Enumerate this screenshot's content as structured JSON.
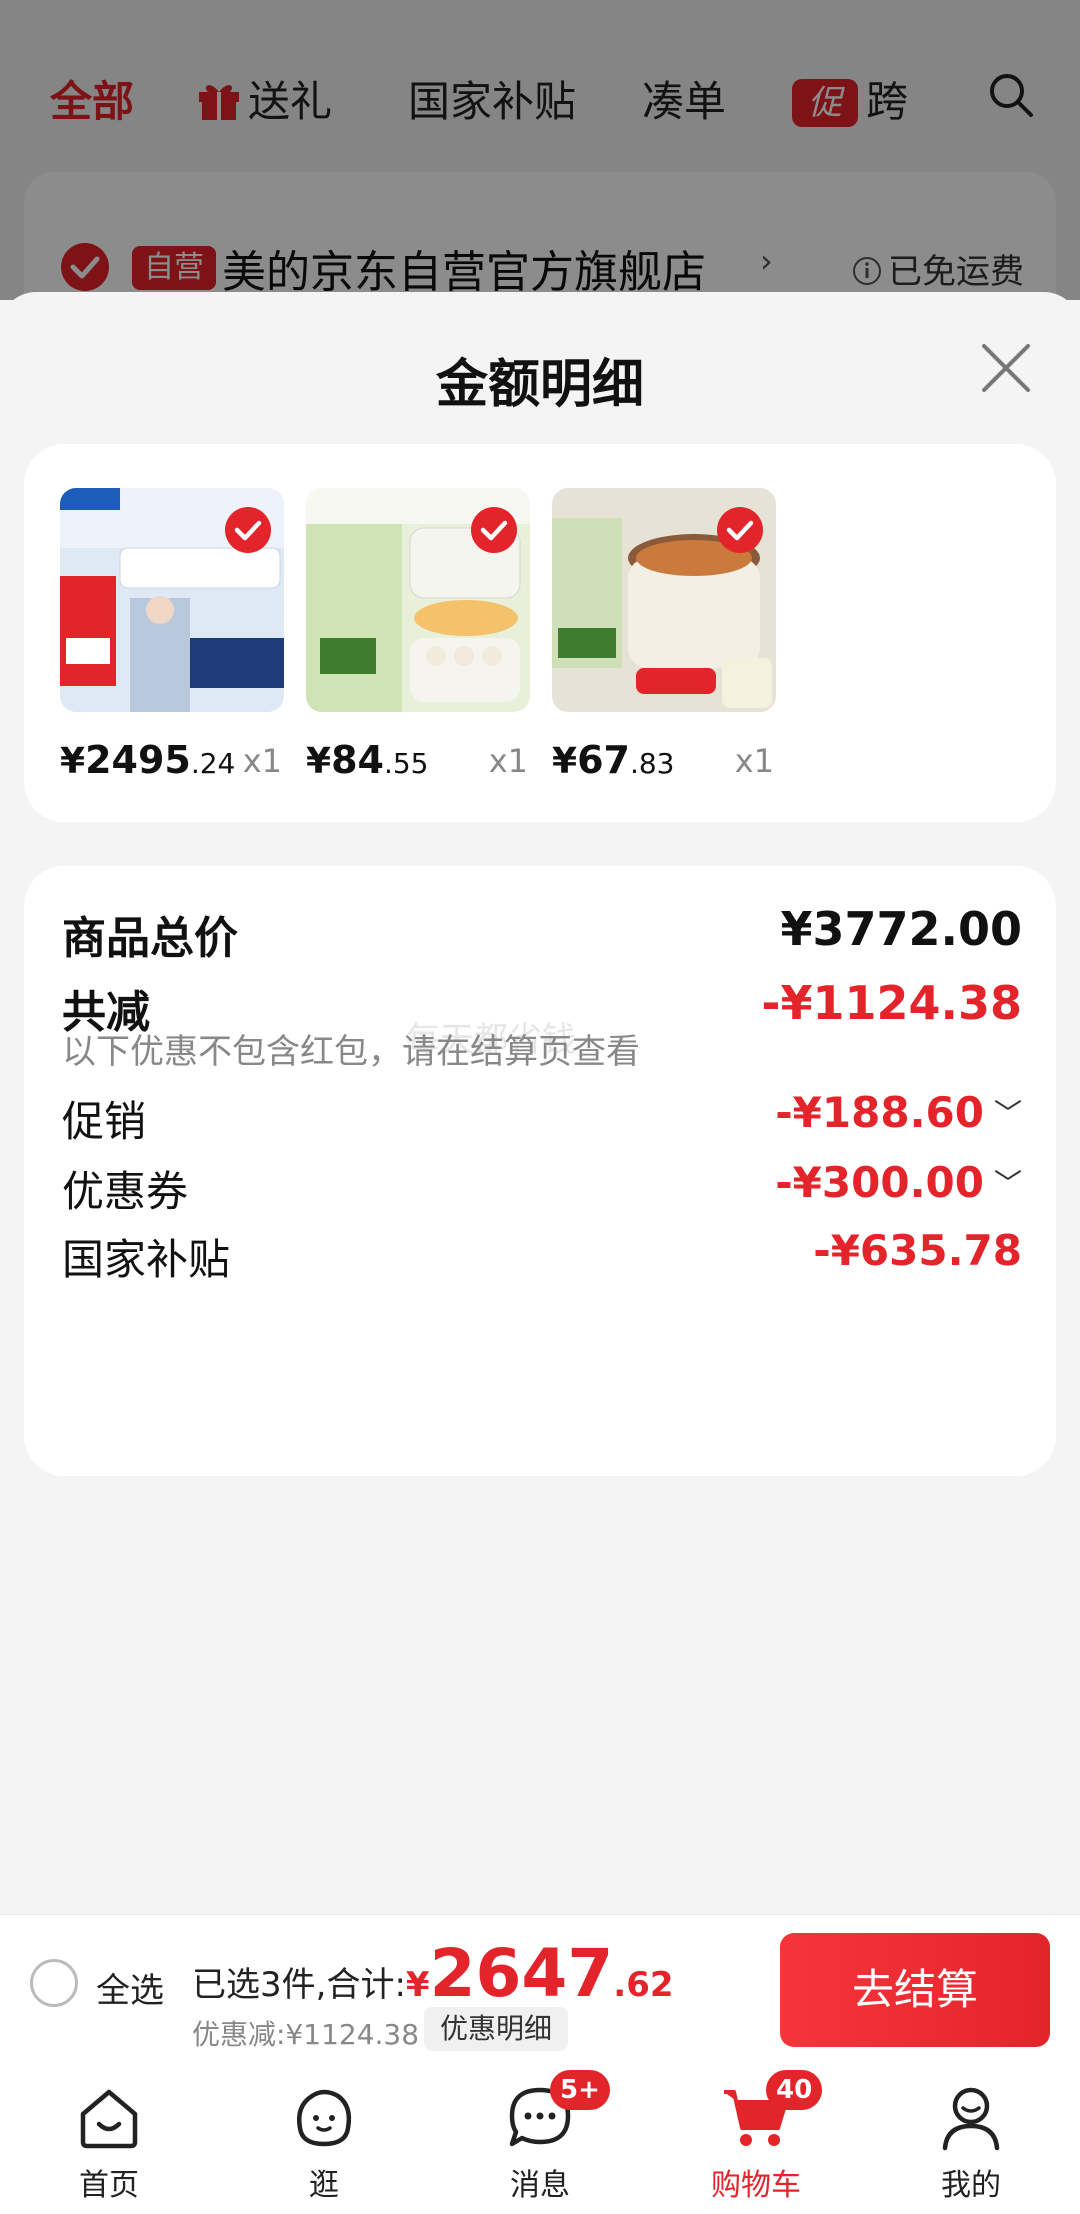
{
  "background": {
    "tabs": [
      {
        "label": "全部",
        "active": true
      },
      {
        "label": "送礼",
        "icon": "gift-icon"
      },
      {
        "label": "国家补贴"
      },
      {
        "label": "凑单"
      },
      {
        "label": "跨",
        "badge": "促"
      }
    ],
    "store": {
      "badge": "自营",
      "name": "美的京东自营官方旗舰店",
      "arrow": "›",
      "shipping": "已免运费"
    }
  },
  "sheet": {
    "title": "金额明细",
    "products": [
      {
        "yen": "¥",
        "int": "2495",
        "dec": ".24",
        "qty": "x1",
        "thumb": "air-conditioner"
      },
      {
        "yen": "¥",
        "int": "84",
        "dec": ".55",
        "qty": "x1",
        "thumb": "egg-steamer"
      },
      {
        "yen": "¥",
        "int": "67",
        "dec": ".83",
        "qty": "x1",
        "thumb": "electric-cooker"
      }
    ],
    "summary": {
      "total_label": "商品总价",
      "total_value": "¥3772.00",
      "reduce_label": "共减",
      "reduce_value": "-¥1124.38",
      "note": "以下优惠不包含红包，请在结算页查看",
      "watermark": "每天都省钱",
      "items": [
        {
          "label": "促销",
          "value": "-¥188.60",
          "chevron": "﹀"
        },
        {
          "label": "优惠券",
          "value": "-¥300.00",
          "chevron": "﹀"
        },
        {
          "label": "国家补贴",
          "value": "-¥635.78"
        }
      ]
    }
  },
  "checkout": {
    "select_all": "全选",
    "selected_label": "已选3件,合计:",
    "yen": "¥",
    "total_int": "2647",
    "total_dec": ".62",
    "saved": "优惠减:¥1124.38",
    "detail_chip": "优惠明细",
    "button": "去结算"
  },
  "nav": [
    {
      "label": "首页",
      "icon": "home-icon"
    },
    {
      "label": "逛",
      "icon": "browse-icon"
    },
    {
      "label": "消息",
      "icon": "message-icon",
      "badge": "5+"
    },
    {
      "label": "购物车",
      "icon": "cart-icon",
      "badge": "40",
      "active": true
    },
    {
      "label": "我的",
      "icon": "profile-icon"
    }
  ],
  "colors": {
    "accent": "#e4242b",
    "background": "#f4f4f4",
    "card": "#ffffff"
  }
}
